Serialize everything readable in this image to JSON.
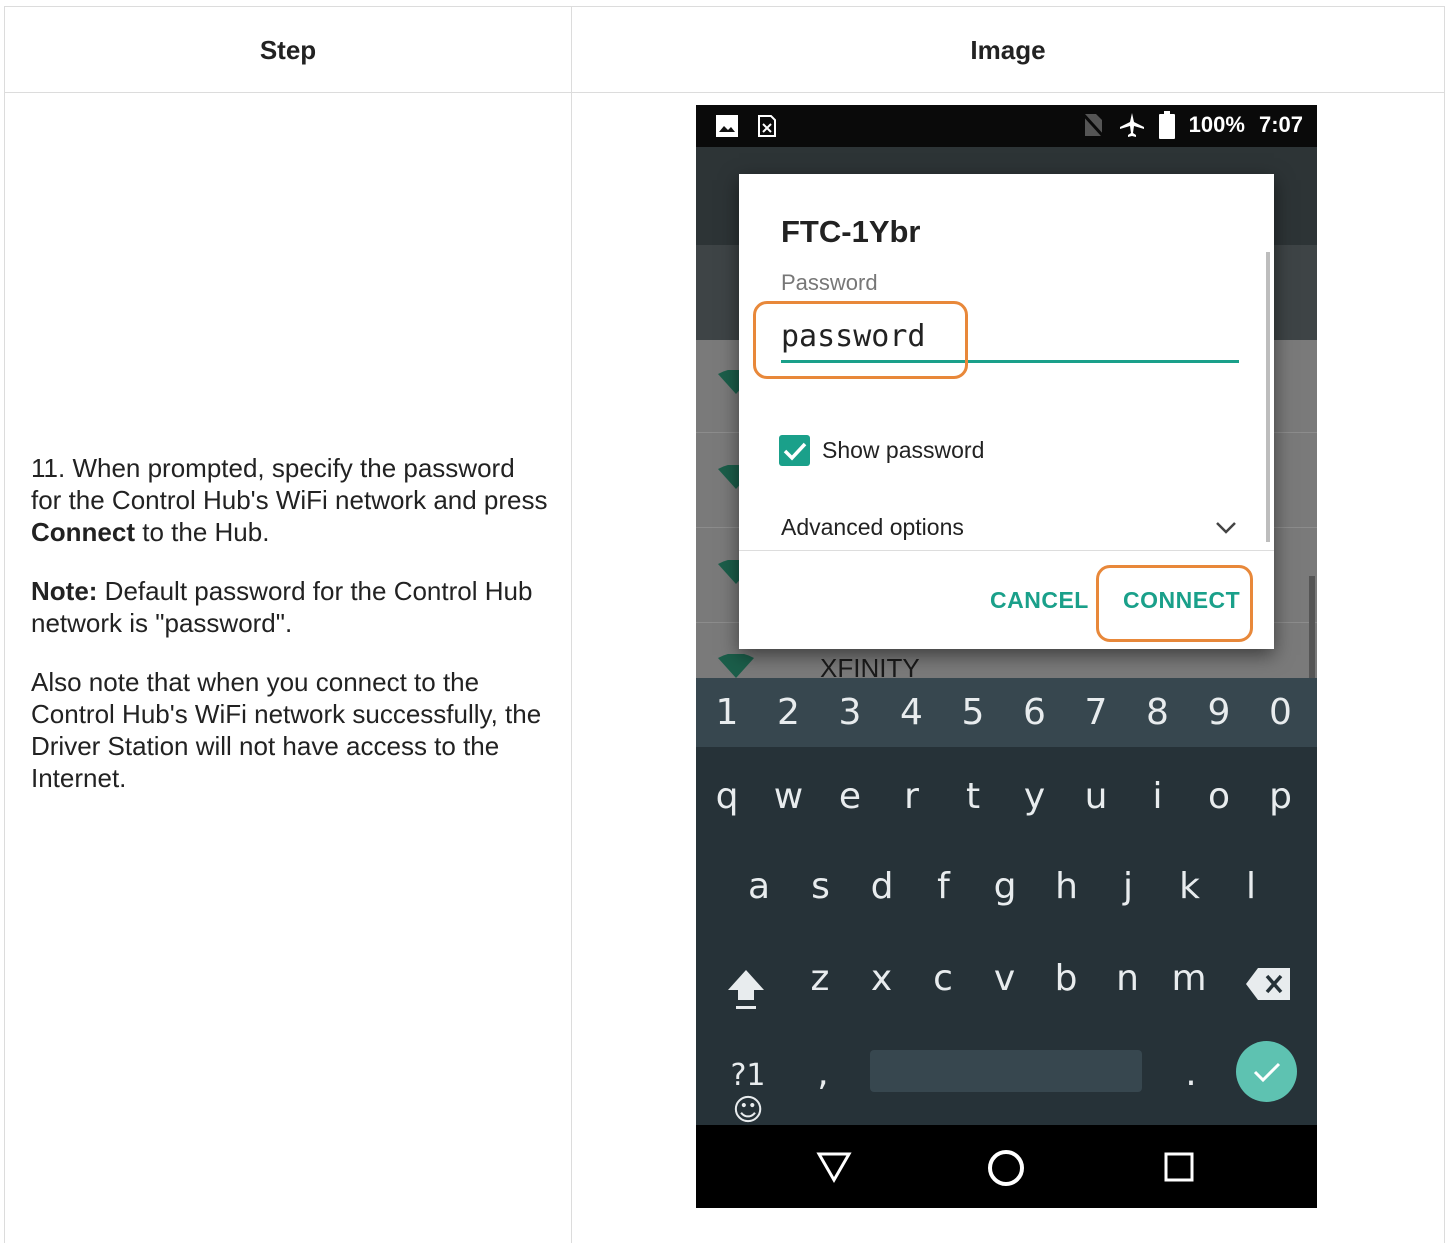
{
  "table": {
    "header_step": "Step",
    "header_image": "Image"
  },
  "step": {
    "line1": "11. When prompted, specify the password for the Control Hub's WiFi network and press",
    "connect_bold": "Connect",
    "line1_tail": " to the Hub.",
    "note_bold": "Note:",
    "note_text": " Default password for the Control Hub network is \"password\".",
    "also_line1": "Also note that when you connect to the Control Hub's WiFi network successfully, the",
    "also_line2": "Driver Station will not have access to the Internet."
  },
  "phone": {
    "status": {
      "battery": "100%",
      "time": "7:07"
    },
    "dialog": {
      "title": "FTC-1Ybr",
      "password_label": "Password",
      "password_value": "password",
      "show_password": "Show password",
      "show_password_checked": true,
      "advanced": "Advanced options",
      "cancel": "CANCEL",
      "connect": "CONNECT"
    },
    "list_peek": "XFINITY",
    "keyboard": {
      "numbers": [
        "1",
        "2",
        "3",
        "4",
        "5",
        "6",
        "7",
        "8",
        "9",
        "0"
      ],
      "row1": [
        "q",
        "w",
        "e",
        "r",
        "t",
        "y",
        "u",
        "i",
        "o",
        "p"
      ],
      "row2": [
        "a",
        "s",
        "d",
        "f",
        "g",
        "h",
        "j",
        "k",
        "l"
      ],
      "row3": [
        "z",
        "x",
        "c",
        "v",
        "b",
        "n",
        "m"
      ],
      "symbols": "?1☺",
      "comma": ",",
      "period": "."
    },
    "colors": {
      "accent": "#1aa08a",
      "highlight": "#e8883a"
    }
  }
}
